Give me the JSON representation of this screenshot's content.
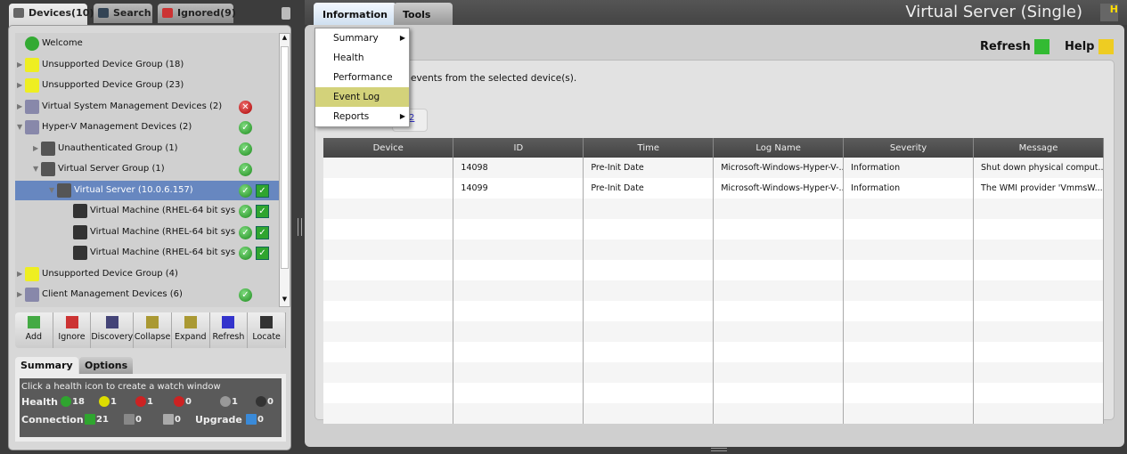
{
  "left_tabs": [
    {
      "label": "Devices(10)"
    },
    {
      "label": "Search"
    },
    {
      "label": "Ignored(9)"
    }
  ],
  "tree": [
    {
      "label": "Welcome",
      "icon": "globe-icon",
      "health": null,
      "conn": false
    },
    {
      "label": "Unsupported Device Group (18)",
      "icon": "question-icon",
      "health": null,
      "conn": false
    },
    {
      "label": "Unsupported Device Group (23)",
      "icon": "question-icon",
      "health": null,
      "conn": false
    },
    {
      "label": "Virtual System Management Devices (2)",
      "icon": "group-icon",
      "health": "error",
      "conn": false
    },
    {
      "label": "Hyper-V Management Devices (2)",
      "icon": "group-icon",
      "health": "ok",
      "conn": false
    },
    {
      "label": "Unauthenticated Group (1)",
      "icon": "locked-server-icon",
      "health": "ok",
      "conn": false
    },
    {
      "label": "Virtual Server Group (1)",
      "icon": "server-icon",
      "health": "ok",
      "conn": false
    },
    {
      "label": "Virtual Server (10.0.6.157)",
      "icon": "server-icon",
      "health": "ok",
      "conn": true,
      "selected": true
    },
    {
      "label": "Virtual Machine (RHEL-64 bit sys",
      "icon": "vm-icon",
      "health": "ok",
      "conn": true
    },
    {
      "label": "Virtual Machine (RHEL-64 bit sys",
      "icon": "vm-icon",
      "health": "ok",
      "conn": true
    },
    {
      "label": "Virtual Machine (RHEL-64 bit sys",
      "icon": "vm-icon",
      "health": "ok",
      "conn": true
    },
    {
      "label": "Unsupported Device Group (4)",
      "icon": "question-icon",
      "health": null,
      "conn": false
    },
    {
      "label": "Client Management Devices (6)",
      "icon": "group-icon",
      "health": "ok",
      "conn": false
    }
  ],
  "toolbar": [
    "Add",
    "Ignore",
    "Discovery",
    "Collapse",
    "Expand",
    "Refresh",
    "Locate"
  ],
  "summary_tabs": [
    "Summary",
    "Options"
  ],
  "summary": {
    "hint": "Click a health icon to create a watch window",
    "health_label": "Health",
    "connection_label": "Connection",
    "upgrade_label": "Upgrade",
    "health": {
      "ok": "18",
      "warning": "1",
      "error": "1",
      "critical": "0",
      "unknown": "1",
      "offline": "0"
    },
    "connection": {
      "ok": "21",
      "broken": "0",
      "unknown": "0"
    },
    "upgrade": "0"
  },
  "right_tabs": [
    "Information",
    "Tools"
  ],
  "title": "Virtual Server (Single)",
  "refresh_label": "Refresh",
  "help_label": "Help",
  "description": "events from the selected device(s).",
  "partial_link": "2",
  "menu": [
    {
      "label": "Summary",
      "sub": true
    },
    {
      "label": "Health",
      "sub": false
    },
    {
      "label": "Performance",
      "sub": false
    },
    {
      "label": "Event Log",
      "sub": false,
      "highlight": true
    },
    {
      "label": "Reports",
      "sub": true
    }
  ],
  "table": {
    "columns": [
      "Device",
      "ID",
      "Time",
      "Log Name",
      "Severity",
      "Message"
    ],
    "rows": [
      [
        "",
        "14098",
        "Pre-Init Date",
        "Microsoft-Windows-Hyper-V-...",
        "Information",
        "Shut down physical comput..."
      ],
      [
        "",
        "14099",
        "Pre-Init Date",
        "Microsoft-Windows-Hyper-V-...",
        "Information",
        "The WMI provider 'VmmsW..."
      ]
    ]
  },
  "colors": {
    "selection": "#6787c0",
    "menu_highlight": "#d3d27a",
    "ok": "#2fa52f"
  }
}
